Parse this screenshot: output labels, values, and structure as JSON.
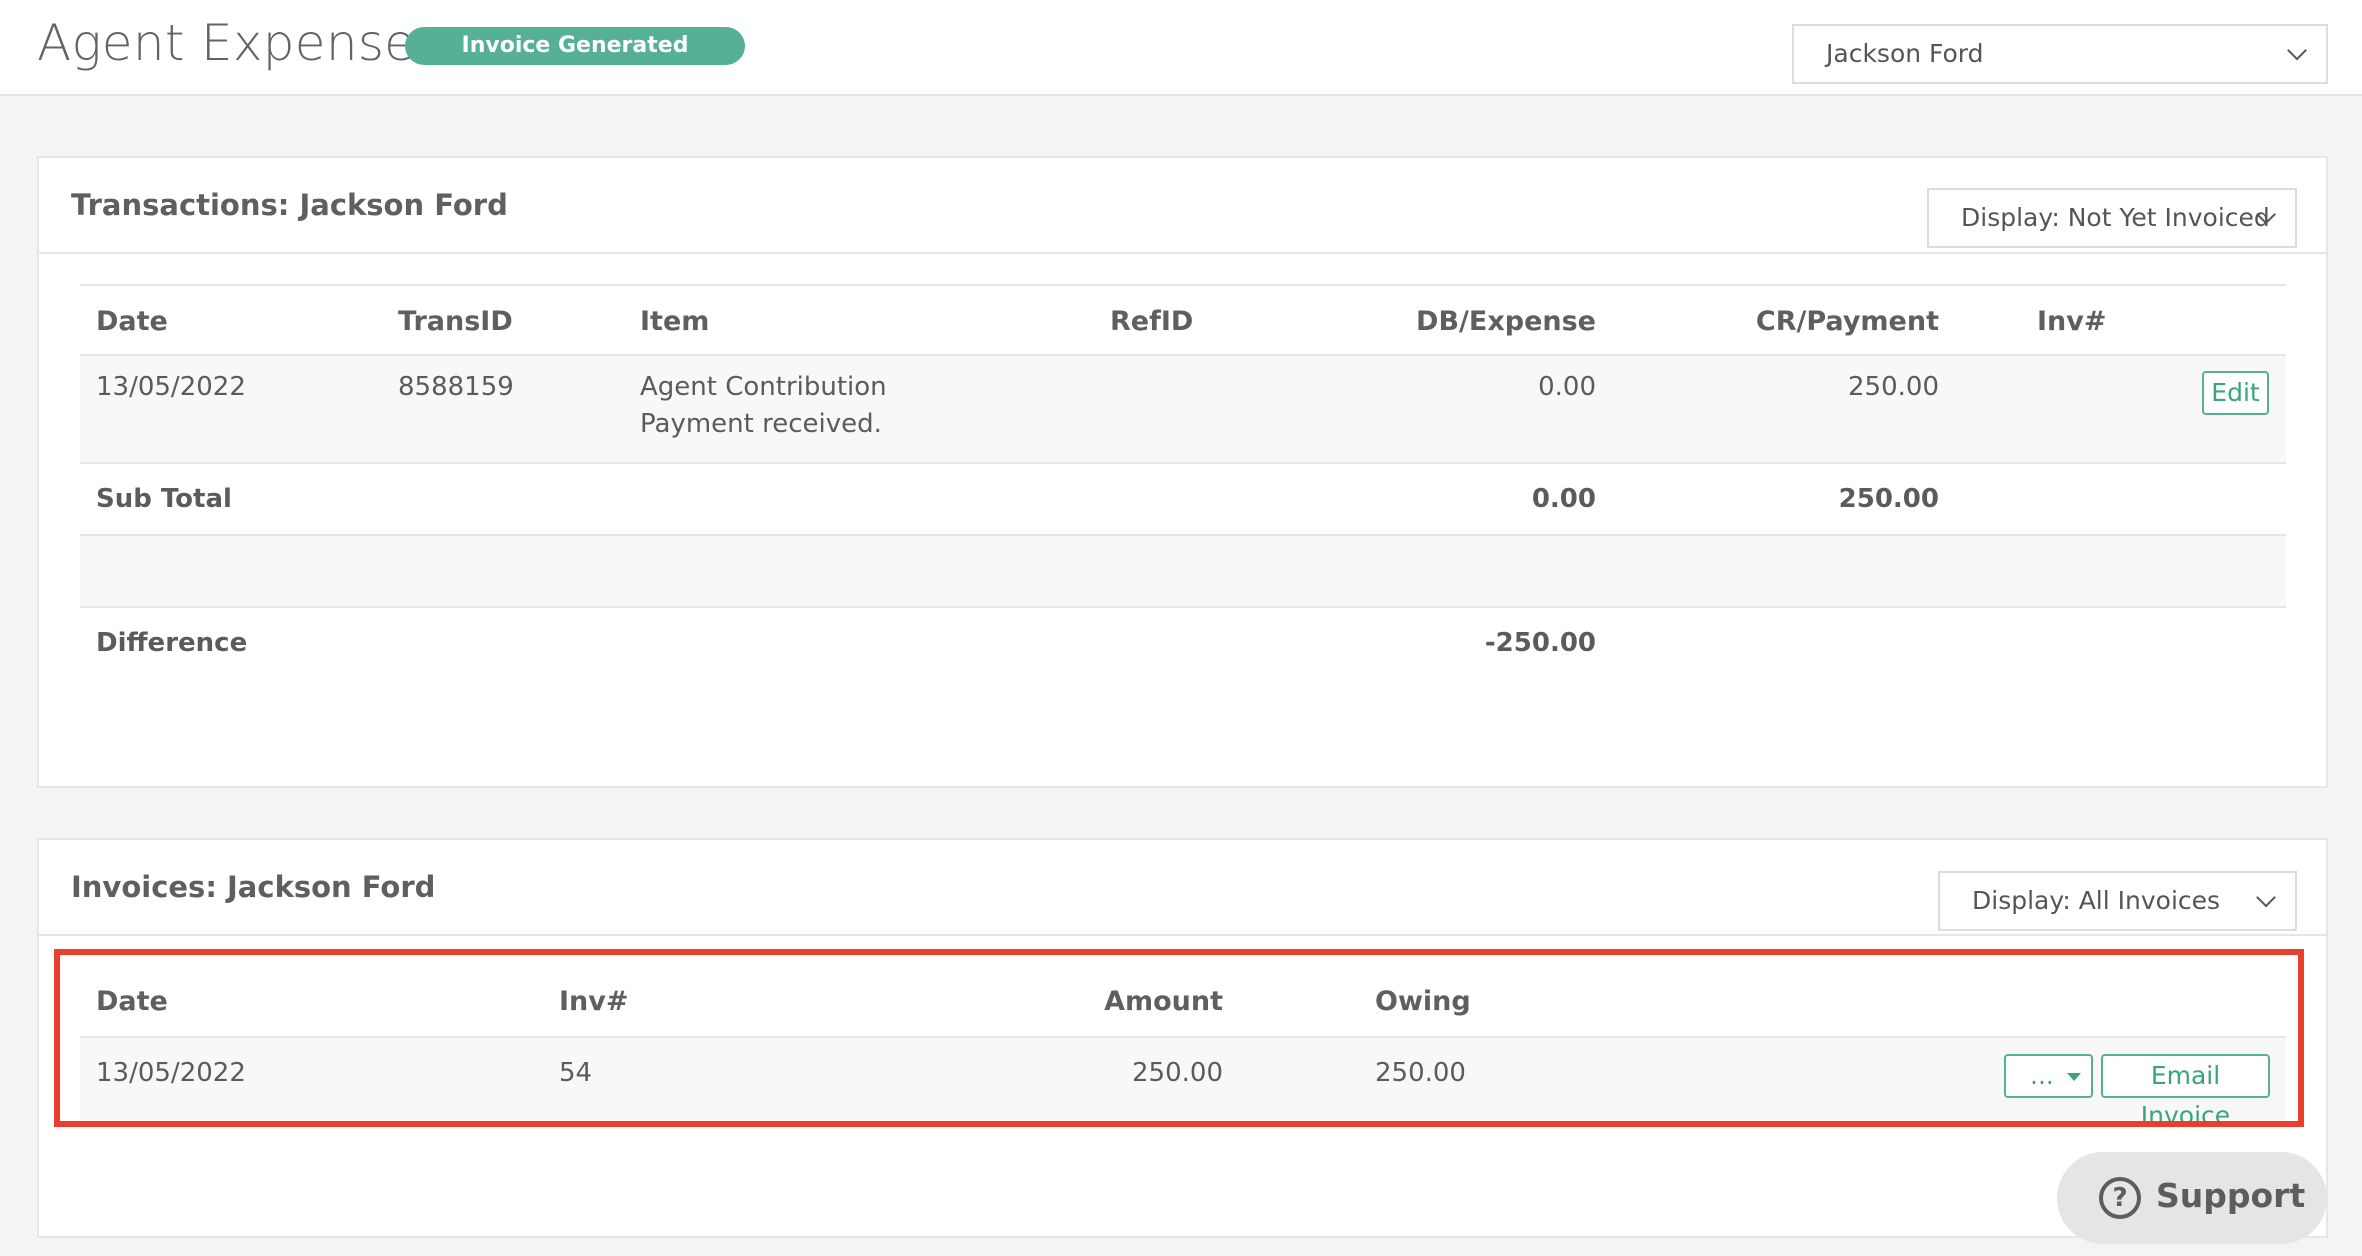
{
  "header": {
    "title": "Agent Expenses",
    "status_badge": "Invoice Generated",
    "agent_select": {
      "value": "Jackson Ford"
    }
  },
  "transactions": {
    "title": "Transactions: Jackson Ford",
    "display_select": "Display: Not Yet Invoiced",
    "columns": [
      "Date",
      "TransID",
      "Item",
      "RefID",
      "DB/Expense",
      "CR/Payment",
      "Inv#"
    ],
    "rows": [
      {
        "date": "13/05/2022",
        "trans_id": "8588159",
        "item_line1": "Agent Contribution",
        "item_line2": "Payment received.",
        "ref_id": "",
        "db_expense": "0.00",
        "cr_payment": "250.00",
        "inv": "",
        "edit_label": "Edit"
      }
    ],
    "subtotal": {
      "label": "Sub Total",
      "db": "0.00",
      "cr": "250.00"
    },
    "difference": {
      "label": "Difference",
      "value": "-250.00"
    }
  },
  "invoices": {
    "title": "Invoices: Jackson Ford",
    "display_select": "Display: All Invoices",
    "columns": [
      "Date",
      "Inv#",
      "Amount",
      "Owing"
    ],
    "rows": [
      {
        "date": "13/05/2022",
        "inv": "54",
        "amount": "250.00",
        "owing": "250.00",
        "more_label": "...",
        "email_label": "Email Invoice"
      }
    ]
  },
  "support": {
    "label": "Support"
  },
  "colors": {
    "accent": "#56b096",
    "highlight": "#e8402c",
    "background": "#f3f4f6"
  }
}
